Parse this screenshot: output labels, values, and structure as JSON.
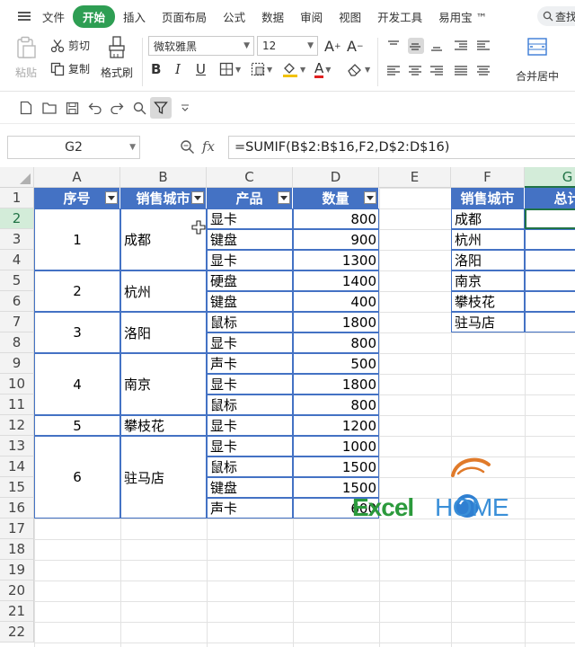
{
  "menu": {
    "items": [
      "文件",
      "开始",
      "插入",
      "页面布局",
      "公式",
      "数据",
      "审阅",
      "视图",
      "开发工具",
      "易用宝 ™"
    ],
    "active_index": 1,
    "search": "查找"
  },
  "ribbon": {
    "paste": "粘贴",
    "cut": "剪切",
    "copy": "复制",
    "format_painter": "格式刷",
    "font_name": "微软雅黑",
    "font_size": "12",
    "merge_center": "合并居中"
  },
  "formula_bar": {
    "name_box": "G2",
    "fx_label": "fx",
    "formula": "=SUMIF(B$2:B$16,F2,D$2:D$16)"
  },
  "sheet": {
    "columns": [
      "A",
      "B",
      "C",
      "D",
      "E",
      "F",
      "G"
    ],
    "rows": [
      "1",
      "2",
      "3",
      "4",
      "5",
      "6",
      "7",
      "8",
      "9",
      "10",
      "11",
      "12",
      "13",
      "14",
      "15",
      "16",
      "17",
      "18",
      "19",
      "20",
      "21",
      "22"
    ],
    "headers": [
      "序号",
      "销售城市",
      "产品",
      "数量"
    ],
    "groups": [
      {
        "seq": "1",
        "city": "成都"
      },
      {
        "seq": "2",
        "city": "杭州"
      },
      {
        "seq": "3",
        "city": "洛阳"
      },
      {
        "seq": "4",
        "city": "南京"
      },
      {
        "seq": "5",
        "city": "攀枝花"
      },
      {
        "seq": "6",
        "city": "驻马店"
      }
    ],
    "products": [
      "显卡",
      "键盘",
      "显卡",
      "硬盘",
      "键盘",
      "鼠标",
      "显卡",
      "声卡",
      "显卡",
      "鼠标",
      "显卡",
      "显卡",
      "鼠标",
      "键盘",
      "声卡"
    ],
    "quantities": [
      "800",
      "900",
      "1300",
      "1400",
      "400",
      "1800",
      "800",
      "500",
      "1800",
      "800",
      "1200",
      "1000",
      "1500",
      "1500",
      "600"
    ],
    "summary_headers": [
      "销售城市",
      "总计"
    ],
    "summary_cities": [
      "成都",
      "杭州",
      "洛阳",
      "南京",
      "攀枝花",
      "驻马店"
    ]
  },
  "watermark": {
    "part1": "Excel",
    "part2": "HOME"
  },
  "colors": {
    "accent_green": "#2e9e53",
    "header_blue": "#4472c4",
    "selection_green": "#217346"
  }
}
